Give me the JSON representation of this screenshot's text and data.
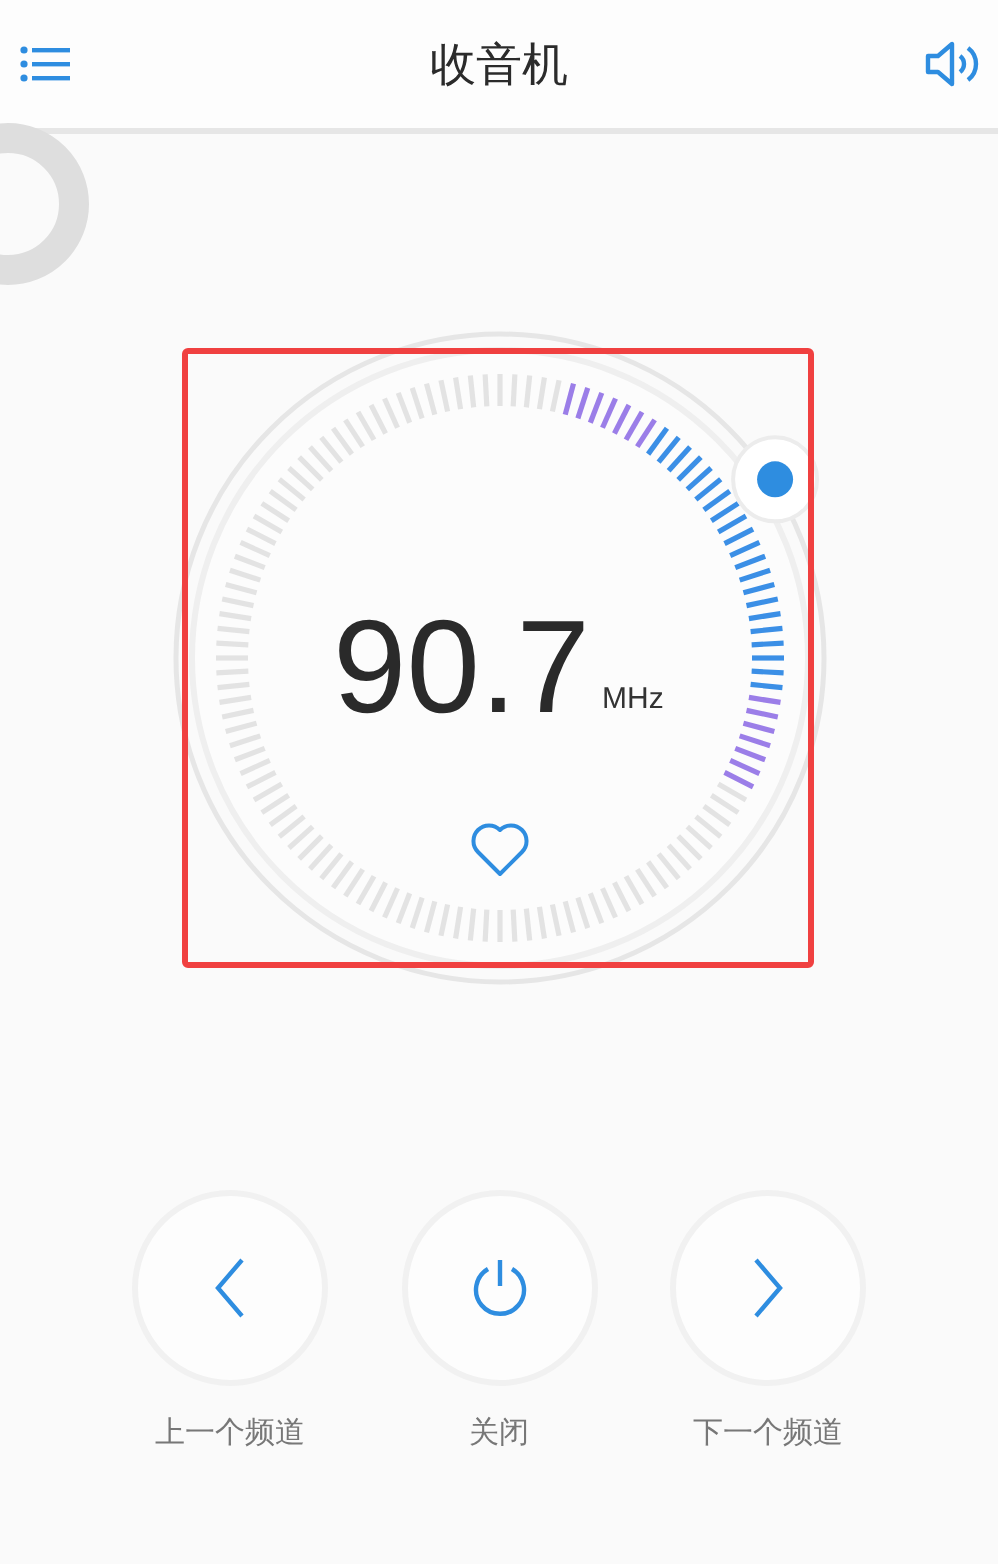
{
  "header": {
    "title": "收音机"
  },
  "tuner": {
    "frequency": "90.7",
    "unit": "MHz",
    "favorite": false
  },
  "controls": [
    {
      "kind": "previous",
      "label": "上一个频道"
    },
    {
      "kind": "power",
      "label": "关闭"
    },
    {
      "kind": "next",
      "label": "下一个频道"
    }
  ]
}
